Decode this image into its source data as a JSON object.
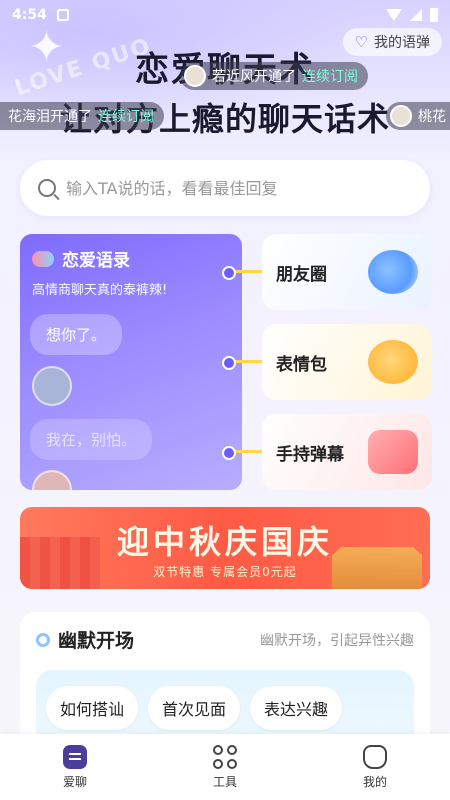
{
  "status": {
    "time": "4:54"
  },
  "header": {
    "watermark": "LOVE QUO",
    "title_line1": "恋爱聊天术",
    "title_line2": "让对方上瘾的聊天话术",
    "my_danmu_label": "我的语弹",
    "tickers": [
      {
        "text": "若近风开通了",
        "link": "连续订阅"
      },
      {
        "text": "花海泪开通了",
        "link": "连续订阅"
      },
      {
        "text": "桃花"
      }
    ]
  },
  "search": {
    "placeholder": "输入TA说的话，看看最佳回复"
  },
  "love_card": {
    "title": "恋爱语录",
    "subtitle": "高情商聊天真的泰裤辣!",
    "bubble1": "想你了。",
    "bubble2": "我在，别怕。"
  },
  "tools": [
    {
      "label": "朋友圈",
      "icon": "friend-circle-icon"
    },
    {
      "label": "表情包",
      "icon": "emoji-icon"
    },
    {
      "label": "手持弹幕",
      "icon": "danmu-icon"
    }
  ],
  "banner": {
    "title": "迎中秋庆国庆",
    "subtitle": "双节特惠  专属会员0元起"
  },
  "section": {
    "title": "幽默开场",
    "desc": "幽默开场，引起异性兴趣",
    "chips": [
      "如何搭讪",
      "首次见面",
      "表达兴趣"
    ]
  },
  "tabbar": [
    {
      "label": "爱聊",
      "icon": "chat-icon"
    },
    {
      "label": "工具",
      "icon": "tools-icon"
    },
    {
      "label": "我的",
      "icon": "profile-icon"
    }
  ],
  "colors": {
    "accent": "#7e6bff",
    "banner": "#ff5a45",
    "link": "#7dffd5"
  }
}
